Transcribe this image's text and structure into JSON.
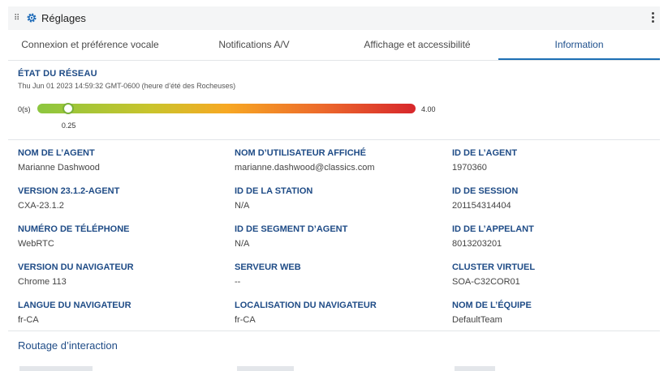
{
  "header": {
    "title": "Réglages"
  },
  "tabs": [
    {
      "label": "Connexion et préférence vocale"
    },
    {
      "label": "Notifications A/V"
    },
    {
      "label": "Affichage et accessibilité"
    },
    {
      "label": "Information"
    }
  ],
  "network": {
    "title": "ÉTAT DU RÉSEAU",
    "timestamp": "Thu Jun 01 2023 14:59:32 GMT-0600 (heure d’été des Rocheuses)",
    "min_label": "0(s)",
    "max_label": "4.00",
    "value_label": "0.25",
    "value": 0.25,
    "max": 4.0,
    "gradient_colors": [
      "#8cc63f",
      "#f7a823",
      "#d7262b"
    ]
  },
  "fields": [
    {
      "label": "NOM DE L’AGENT",
      "value": "Marianne Dashwood"
    },
    {
      "label": "NOM D’UTILISATEUR AFFICHÉ",
      "value": "marianne.dashwood@classics.com"
    },
    {
      "label": "ID DE L’AGENT",
      "value": "1970360"
    },
    {
      "label": "VERSION 23.1.2-AGENT",
      "value": "CXA-23.1.2"
    },
    {
      "label": "ID DE LA STATION",
      "value": "N/A"
    },
    {
      "label": "ID DE SESSION",
      "value": "201154314404"
    },
    {
      "label": "NUMÉRO DE TÉLÉPHONE",
      "value": "WebRTC"
    },
    {
      "label": "ID DE SEGMENT D’AGENT",
      "value": "N/A"
    },
    {
      "label": "ID DE L’APPELANT",
      "value": "8013203201"
    },
    {
      "label": "VERSION DU NAVIGATEUR",
      "value": "Chrome 113"
    },
    {
      "label": "SERVEUR WEB",
      "value": "--"
    },
    {
      "label": "CLUSTER VIRTUEL",
      "value": "SOA-C32COR01"
    },
    {
      "label": "LANGUE DU NAVIGATEUR",
      "value": "fr-CA"
    },
    {
      "label": "LOCALISATION DU NAVIGATEUR",
      "value": "fr-CA"
    },
    {
      "label": "NOM DE L’ÉQUIPE",
      "value": "DefaultTeam"
    }
  ],
  "routing": {
    "title": "Routage d’interaction"
  },
  "colors": {
    "accent": "#1e4b86",
    "tab_underline": "#1d6fb5"
  }
}
